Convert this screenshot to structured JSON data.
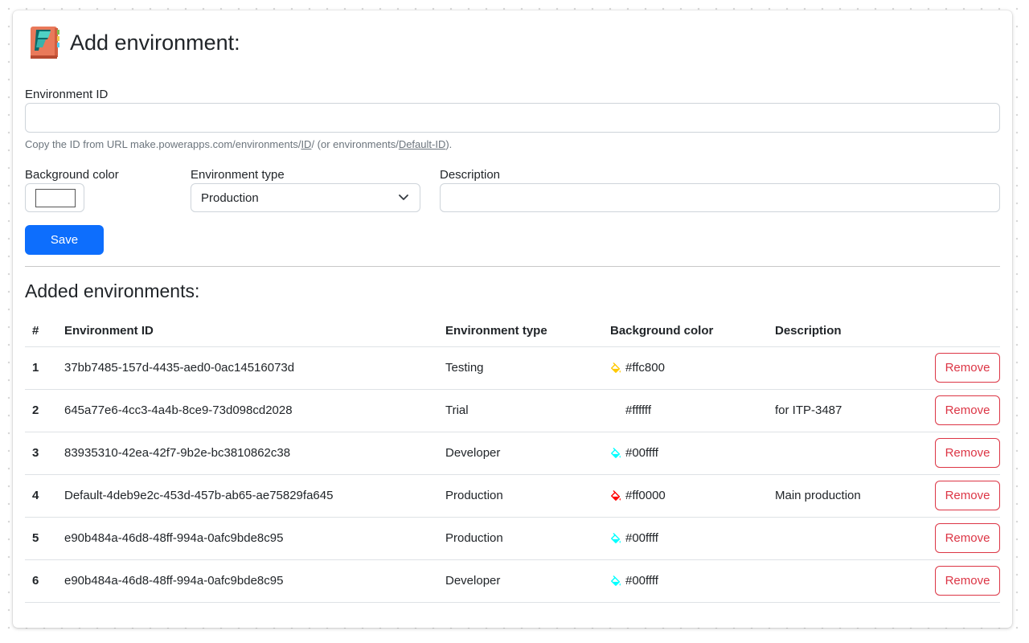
{
  "header": {
    "title": "Add environment:"
  },
  "form": {
    "env_id_label": "Environment ID",
    "env_id_value": "",
    "help_prefix": "Copy the ID from URL make.powerapps.com/environments/",
    "help_id": "ID",
    "help_middle": "/ (or environments/",
    "help_default": "Default-ID",
    "help_suffix": ").",
    "bg_color_label": "Background color",
    "bg_color_value": "#ffffff",
    "env_type_label": "Environment type",
    "env_type_selected": "Production",
    "description_label": "Description",
    "description_value": "",
    "save_label": "Save"
  },
  "table": {
    "title": "Added environments:",
    "headers": [
      "#",
      "Environment ID",
      "Environment type",
      "Background color",
      "Description"
    ],
    "remove_label": "Remove",
    "rows": [
      {
        "num": "1",
        "id": "37bb7485-157d-4435-aed0-0ac14516073d",
        "type": "Testing",
        "color": "#ffc800",
        "description": ""
      },
      {
        "num": "2",
        "id": "645a77e6-4cc3-4a4b-8ce9-73d098cd2028",
        "type": "Trial",
        "color": "#ffffff",
        "description": "for ITP-3487"
      },
      {
        "num": "3",
        "id": "83935310-42ea-42f7-9b2e-bc3810862c38",
        "type": "Developer",
        "color": "#00ffff",
        "description": ""
      },
      {
        "num": "4",
        "id": "Default-4deb9e2c-453d-457b-ab65-ae75829fa645",
        "type": "Production",
        "color": "#ff0000",
        "description": "Main production"
      },
      {
        "num": "5",
        "id": "e90b484a-46d8-48ff-994a-0afc9bde8c95",
        "type": "Production",
        "color": "#00ffff",
        "description": ""
      },
      {
        "num": "6",
        "id": "e90b484a-46d8-48ff-994a-0afc9bde8c95",
        "type": "Developer",
        "color": "#00ffff",
        "description": ""
      }
    ]
  },
  "colors": {
    "primary": "#0d6efd",
    "danger": "#dc3545"
  }
}
